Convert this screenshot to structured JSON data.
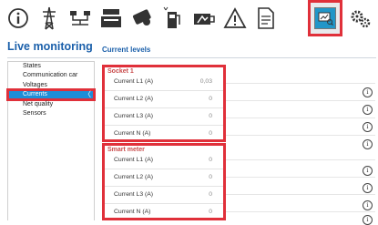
{
  "header": {
    "title": "Live monitoring",
    "subtitle": "Current levels"
  },
  "toolbar": {
    "icons": [
      "info-icon",
      "power-tower-icon",
      "distribution-icon",
      "cash-register-icon",
      "payment-card-icon",
      "charging-station-icon",
      "vehicle-charging-icon",
      "warning-icon",
      "document-icon",
      "live-monitor-icon",
      "settings-gears-icon"
    ],
    "active": "live-monitor-icon"
  },
  "menu": {
    "items": [
      {
        "label": "States"
      },
      {
        "label": "Communication car"
      },
      {
        "label": "Voltages"
      },
      {
        "label": "Currents"
      },
      {
        "label": "Net quality"
      },
      {
        "label": "Sensors"
      }
    ],
    "selected_index": 3,
    "selected_chevron": "〈"
  },
  "groups": [
    {
      "title": "Socket 1",
      "rows": [
        {
          "label": "Current L1 (A)",
          "value": "0,03"
        },
        {
          "label": "Current L2 (A)",
          "value": "0"
        },
        {
          "label": "Current L3 (A)",
          "value": "0"
        },
        {
          "label": "Current N (A)",
          "value": "0"
        }
      ]
    },
    {
      "title": "Smart meter",
      "rows": [
        {
          "label": "Current L1 (A)",
          "value": "0"
        },
        {
          "label": "Current L2 (A)",
          "value": "0"
        },
        {
          "label": "Current L3 (A)",
          "value": "0"
        },
        {
          "label": "Current N (A)",
          "value": "0"
        }
      ]
    }
  ],
  "info_glyph": "i",
  "colors": {
    "accent_blue": "#1a5faa",
    "selected_bg": "#1e8ed8",
    "highlight_red": "#e0303a",
    "group_title": "#c94b4b"
  }
}
